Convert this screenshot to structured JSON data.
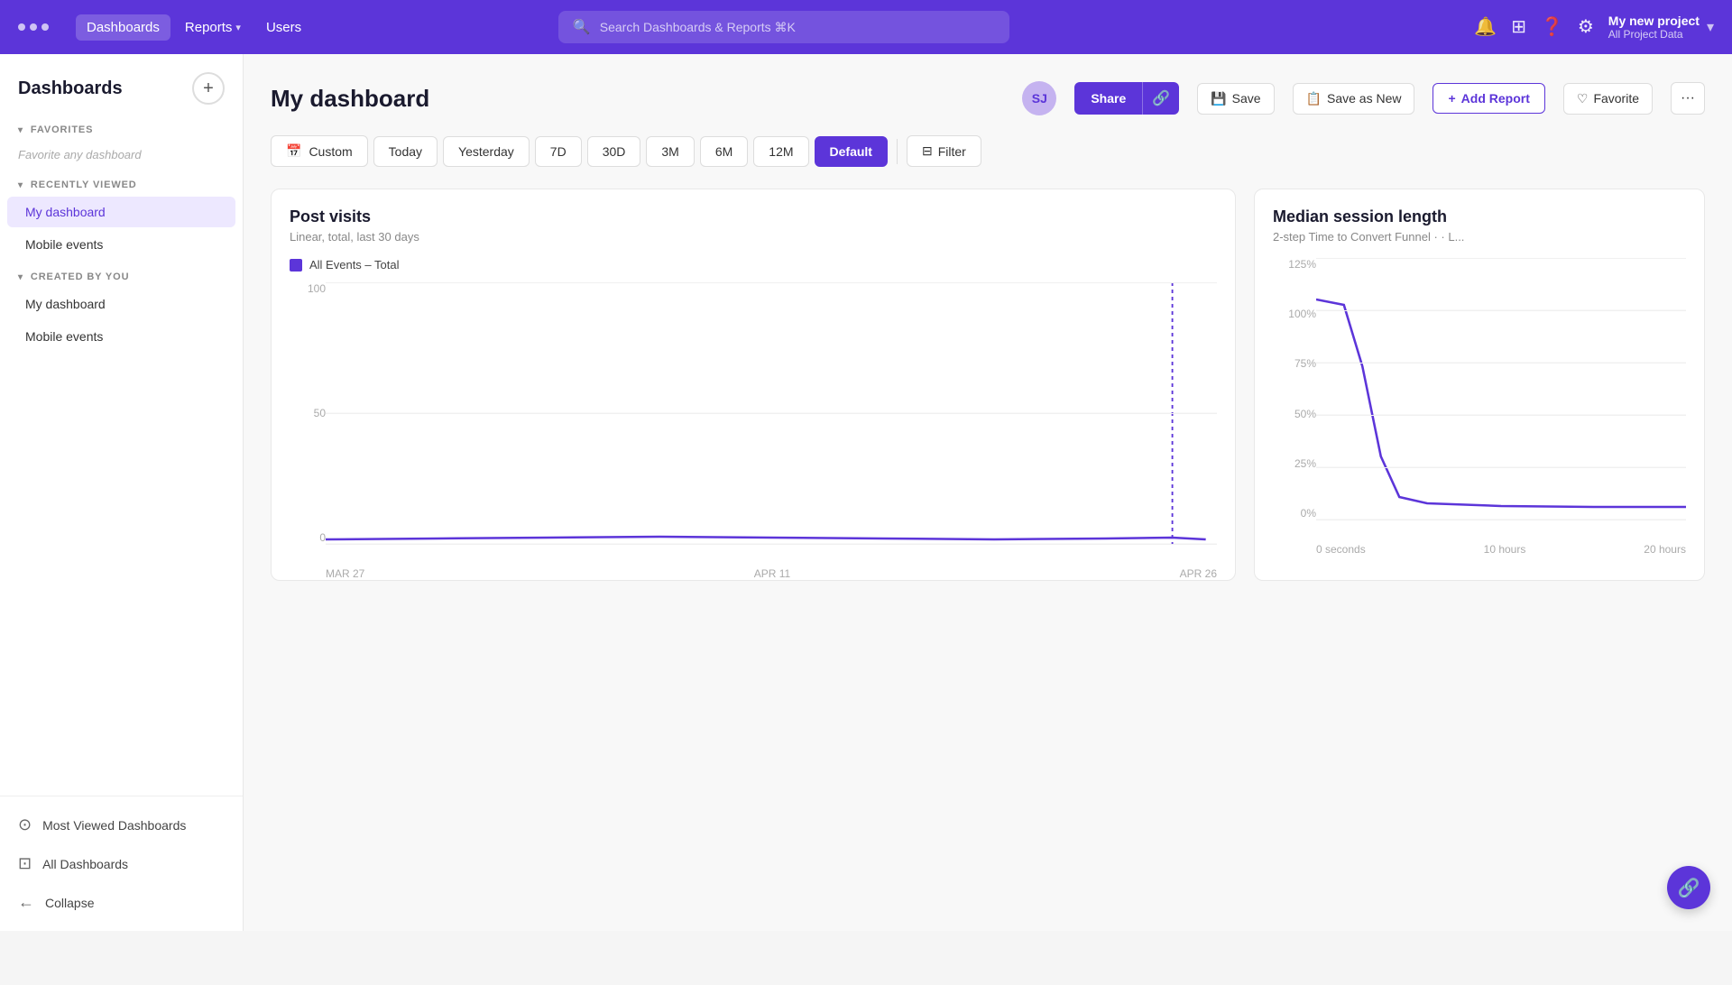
{
  "topnav": {
    "logo_dots": [
      "dot1",
      "dot2",
      "dot3"
    ],
    "links": [
      {
        "label": "Dashboards",
        "active": true
      },
      {
        "label": "Reports",
        "active": false,
        "has_arrow": true
      },
      {
        "label": "Users",
        "active": false
      }
    ],
    "search_placeholder": "Search Dashboards & Reports ⌘K",
    "project_name": "My new project",
    "project_sub": "All Project Data"
  },
  "sidebar": {
    "title": "Dashboards",
    "add_btn_label": "+",
    "sections": {
      "favorites": {
        "label": "FAVORITES",
        "empty_text": "Favorite any dashboard"
      },
      "recently_viewed": {
        "label": "RECENTLY VIEWED",
        "items": [
          "My dashboard",
          "Mobile events"
        ]
      },
      "created_by_you": {
        "label": "CREATED BY YOU",
        "items": [
          "My dashboard",
          "Mobile events"
        ]
      }
    },
    "footer": [
      {
        "label": "Most Viewed Dashboards",
        "icon": "⊙"
      },
      {
        "label": "All Dashboards",
        "icon": "⊡"
      },
      {
        "label": "Collapse",
        "icon": "←"
      }
    ]
  },
  "dashboard": {
    "title": "My dashboard",
    "avatar": "SJ",
    "buttons": {
      "share": "Share",
      "save": "Save",
      "save_as_new": "Save as New",
      "add_report": "Add Report",
      "favorite": "Favorite"
    },
    "filter_buttons": [
      {
        "label": "Custom",
        "active": false,
        "has_icon": true
      },
      {
        "label": "Today",
        "active": false
      },
      {
        "label": "Yesterday",
        "active": false
      },
      {
        "label": "7D",
        "active": false
      },
      {
        "label": "30D",
        "active": false
      },
      {
        "label": "3M",
        "active": false
      },
      {
        "label": "6M",
        "active": false
      },
      {
        "label": "12M",
        "active": false
      },
      {
        "label": "Default",
        "active": true
      }
    ],
    "filter_label": "Filter"
  },
  "charts": {
    "post_visits": {
      "title": "Post visits",
      "subtitle": "Linear, total, last 30 days",
      "legend": "All Events – Total",
      "legend_color": "#5c35d9",
      "y_labels": [
        "100",
        "50",
        "0"
      ],
      "x_labels": [
        "MAR 27",
        "APR 11",
        "APR 26"
      ]
    },
    "median_session": {
      "title": "Median session length",
      "subtitle": "2-step Time to Convert Funnel · · L...",
      "y_labels": [
        "125%",
        "100%",
        "75%",
        "50%",
        "25%",
        "0%"
      ],
      "x_labels": [
        "0 seconds",
        "10 hours",
        "20 hours"
      ]
    }
  }
}
